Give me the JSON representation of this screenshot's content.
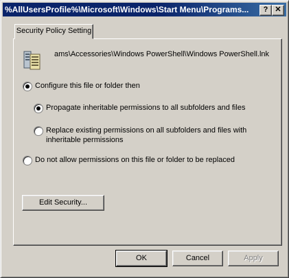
{
  "window": {
    "title": "%AllUsersProfile%\\Microsoft\\Windows\\Start Menu\\Programs..."
  },
  "title_buttons": {
    "help": "?",
    "close": "✕"
  },
  "tab": {
    "label": "Security Policy Setting"
  },
  "file": {
    "icon": "file-server-icon",
    "path": "ams\\Accessories\\Windows PowerShell\\Windows PowerShell.lnk"
  },
  "options": {
    "configure": "Configure this file or folder then",
    "propagate": "Propagate inheritable permissions to all subfolders and files",
    "replace_line1": "Replace existing permissions on all subfolders and files with",
    "replace_line2": "inheritable permissions",
    "do_not_allow": "Do not allow permissions on this file or folder to be replaced"
  },
  "buttons": {
    "edit_security": "Edit Security...",
    "ok": "OK",
    "cancel": "Cancel",
    "apply": "Apply"
  }
}
